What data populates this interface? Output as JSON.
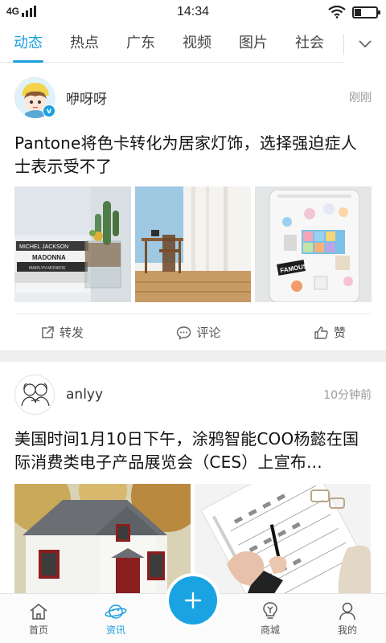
{
  "status_bar": {
    "network": "4G",
    "time": "14:34"
  },
  "tabs": [
    {
      "label": "动态",
      "active": true
    },
    {
      "label": "热点",
      "active": false
    },
    {
      "label": "广东",
      "active": false
    },
    {
      "label": "视频",
      "active": false
    },
    {
      "label": "图片",
      "active": false
    },
    {
      "label": "社会",
      "active": false
    }
  ],
  "tabs_more_icon": "chevron-down-icon",
  "accent_color": "#1a9fe0",
  "posts": [
    {
      "username": "咿呀呀",
      "time": "刚刚",
      "verified": true,
      "title": "Pantone将色卡转化为居家灯饰，选择强迫症人士表示受不了",
      "image_text": [
        "MICHEL JACKSON",
        "MADONNA",
        "MARILYN MONROE",
        "FAMOUS"
      ],
      "actions": {
        "share": "转发",
        "comment": "评论",
        "like": "赞"
      }
    },
    {
      "username": "anlyy",
      "time": "10分钟前",
      "verified": false,
      "title": "美国时间1月10日下午，涂鸦智能COO杨懿在国际消费类电子产品展览会（CES）上宣布..."
    }
  ],
  "bottom_nav": [
    {
      "label": "首页",
      "icon": "home-icon",
      "active": false
    },
    {
      "label": "资讯",
      "icon": "planet-icon",
      "active": true
    },
    {
      "label": "商城",
      "icon": "lightbulb-icon",
      "active": false
    },
    {
      "label": "我的",
      "icon": "person-icon",
      "active": false
    }
  ],
  "fab_icon": "plus-icon"
}
